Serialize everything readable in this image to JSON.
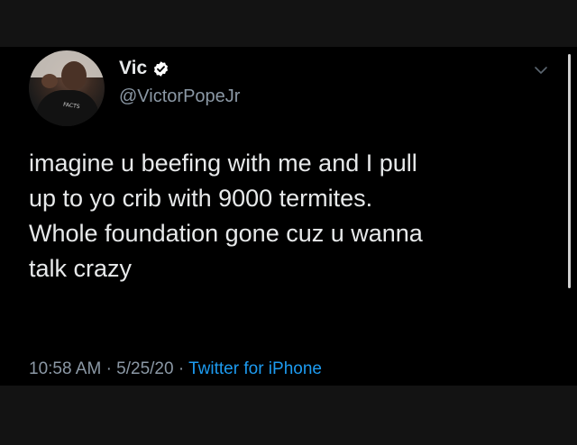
{
  "tweet": {
    "display_name": "Vic",
    "handle": "@VictorPopeJr",
    "text": "imagine u beefing with me and I pull\nup to yo crib with 9000 termites.\nWhole foundation gone cuz u wanna\ntalk crazy",
    "time": "10:58 AM",
    "date": "5/25/20",
    "separator": "·",
    "source": "Twitter for iPhone"
  },
  "avatar": {
    "shirt_print": "FACTS"
  },
  "icons": {
    "verified": "verified-badge-icon",
    "more": "chevron-down-icon"
  },
  "colors": {
    "background": "#000000",
    "text": "#e7e9ea",
    "muted": "#8b98a5",
    "link": "#1d9bf0"
  }
}
